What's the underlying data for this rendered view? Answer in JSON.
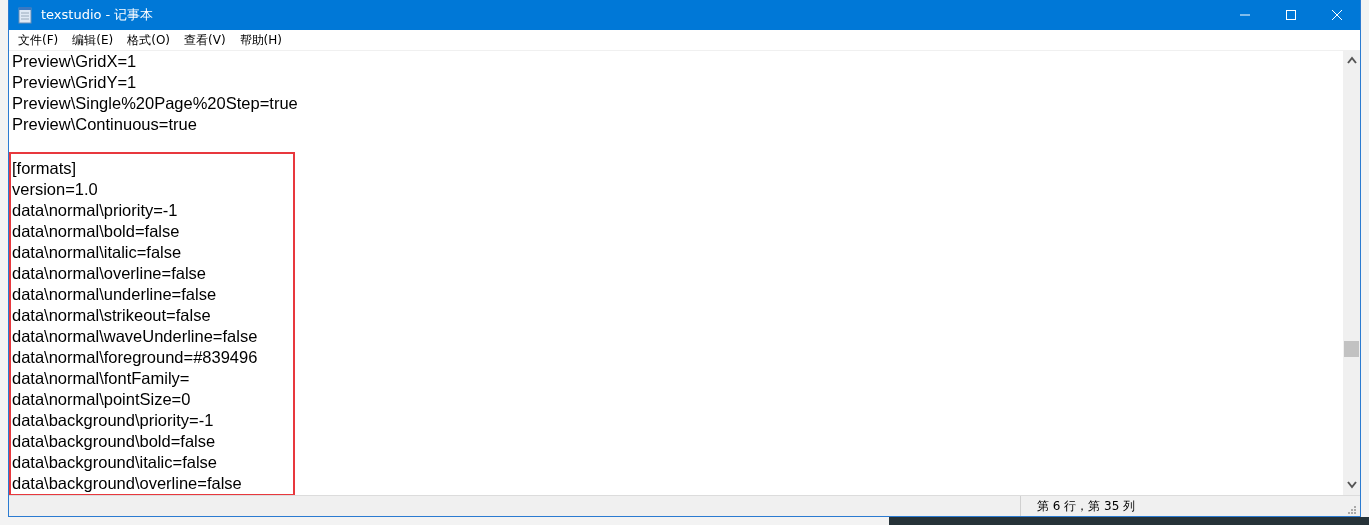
{
  "window": {
    "title": "texstudio - 记事本"
  },
  "menu": [
    "文件(F)",
    "编辑(E)",
    "格式(O)",
    "查看(V)",
    "帮助(H)"
  ],
  "editor": {
    "lines": [
      "Preview\\GridX=1",
      "Preview\\GridY=1",
      "Preview\\Single%20Page%20Step=true",
      "Preview\\Continuous=true"
    ],
    "highlighted_lines": [
      "[formats]",
      "version=1.0",
      "data\\normal\\priority=-1",
      "data\\normal\\bold=false",
      "data\\normal\\italic=false",
      "data\\normal\\overline=false",
      "data\\normal\\underline=false",
      "data\\normal\\strikeout=false",
      "data\\normal\\waveUnderline=false",
      "data\\normal\\foreground=#839496",
      "data\\normal\\fontFamily=",
      "data\\normal\\pointSize=0",
      "data\\background\\priority=-1",
      "data\\background\\bold=false",
      "data\\background\\italic=false",
      "data\\background\\overline=false"
    ]
  },
  "status_bar": {
    "position": "第 6 行，第 35 列"
  }
}
